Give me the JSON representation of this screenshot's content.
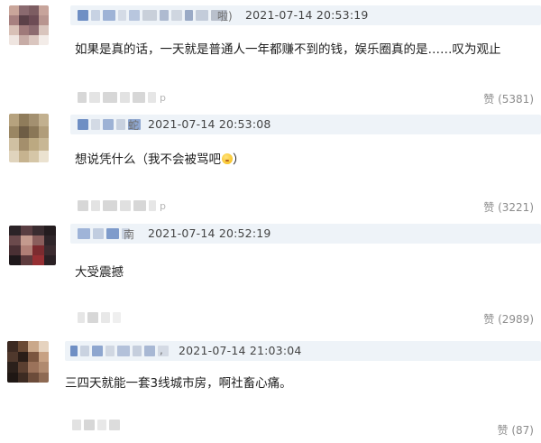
{
  "comments": [
    {
      "name_tail": "啦)",
      "timestamp": "2021-07-14 20:53:19",
      "text": "如果是真的话，一天就是普通人一年都赚不到的钱，娱乐圈真的是……叹为观止",
      "footer_tail": "p",
      "like_label": "赞",
      "like_count": "(5381)"
    },
    {
      "name_tail": "蛇",
      "timestamp": "2021-07-14 20:53:08",
      "text": "想说凭什么（我不会被骂吧",
      "emoji": "smirk-emoji",
      "footer_tail": "p",
      "like_label": "赞",
      "like_count": "(3221)"
    },
    {
      "name_tail": "南",
      "timestamp": "2021-07-14 20:52:19",
      "text": "大受震撼",
      "footer_tail": "",
      "like_label": "赞",
      "like_count": "(2989)"
    },
    {
      "name_tail": ",",
      "timestamp": "2021-07-14 21:03:04",
      "text": "三四天就能一套3线城市房，啊社畜心痛。",
      "footer_tail": "",
      "like_label": "赞",
      "like_count": "(87)"
    }
  ],
  "colors": {
    "header_bg": "#eef3f8",
    "timestamp": "#444444",
    "like": "#8c8c8c",
    "name_blue": "#6f8fc4"
  }
}
